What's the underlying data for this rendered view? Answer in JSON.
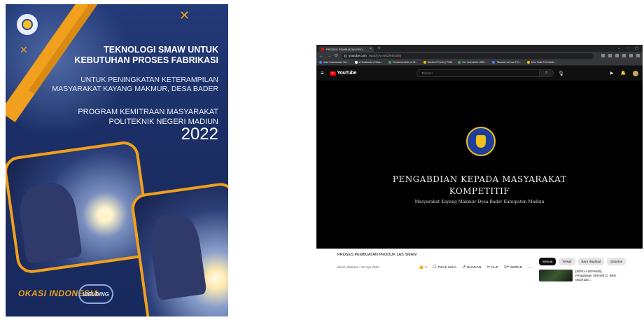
{
  "poster": {
    "title_line1": "TEKNOLOGI SMAW UNTUK",
    "title_line2": "KEBUTUHAN PROSES FABRIKASI",
    "subtitle_line1": "UNTUK PENINGKATAN KETERAMPILAN",
    "subtitle_line2": "MASYARAKAT KAYANG MAKMUR, DESA BADER",
    "program_line1": "PROGRAM KEMITRAAN MASYARAKAT",
    "program_line2": "POLITEKNIK NEGERI MADIUN",
    "year": "2022",
    "footer_logo1": "OKASI INDONESIA",
    "footer_logo2": "WELDING",
    "colors": {
      "background": "#1b2f66",
      "accent": "#f0a01c"
    }
  },
  "browser": {
    "tab": {
      "label": "PROSES PEMBUATAN PRO...",
      "close": "×"
    },
    "new_tab": "+",
    "window_controls": [
      "⌄",
      "–",
      "▢"
    ],
    "address": {
      "host": "youtube.com",
      "path": "/watch?v=w0ZH4Eu8I0"
    },
    "bookmarks": [
      {
        "label": "Also Indonesian Sel...",
        "color": "#4285f4"
      },
      {
        "label": "A Textbook of Mac...",
        "color": "#ffffff"
      },
      {
        "label": "Fundamentals of M...",
        "color": "#34a853"
      },
      {
        "label": "Student Portal | PNM",
        "color": "#fbbc05"
      },
      {
        "label": "Uzi Inventaris UBN...",
        "color": "#34a853"
      },
      {
        "label": "Tikasari semua Pol...",
        "color": "#4285f4"
      },
      {
        "label": "Mini Task Portofolio...",
        "color": "#fbbc05"
      }
    ]
  },
  "youtube": {
    "logo_text": "YouTube",
    "search_placeholder": "Telusuri",
    "video": {
      "title_line1": "PENGABDIAN KEPADA MASYARAKAT",
      "title_line2": "KOMPETITIF",
      "subtitle": "Masyarakat Kayang Makmur Desa Bader Kabupaten Madiun"
    },
    "video_title": "PROSES PEMBUATAN PRODUK LAS SMAW",
    "video_meta": "Belum ditonton • 21 Agu 2022",
    "actions": [
      {
        "icon": "👍",
        "label": "1"
      },
      {
        "icon": "☐",
        "label": "TIDAK SUKA"
      },
      {
        "icon": "↗",
        "label": "BAGIKAN"
      },
      {
        "icon": "✂",
        "label": "KLIP"
      },
      {
        "icon": "≡+",
        "label": "SIMPAN"
      },
      {
        "icon": "…",
        "label": ""
      }
    ],
    "chips": [
      "Semua",
      "Terkait",
      "Baru diupload",
      "Ditonton"
    ],
    "recommendation": {
      "title": "[SEPLH SERAMS] Pengelasan SMAW/LG, Bikin Mobil dari..."
    }
  }
}
